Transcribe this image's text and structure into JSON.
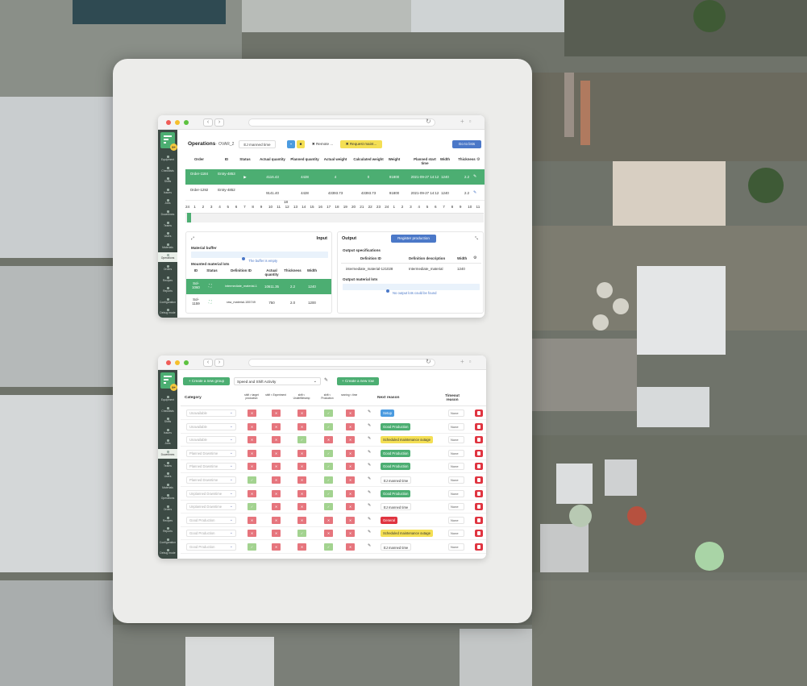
{
  "colors": {
    "green": "#4cae72",
    "red": "#e6757d",
    "blue": "#4b78c8",
    "yellow": "#f4df54",
    "lightgreen": "#a3d390",
    "sidebar": "#3c4a44"
  },
  "browser": {
    "reload_icon": "reload-icon",
    "back_icon": "chevron-left-icon",
    "forward_icon": "chevron-right-icon"
  },
  "win1": {
    "sidebar": [
      "Equipment",
      "Checklists",
      "Shifts",
      "Issues",
      "Jobs",
      "Downtimes",
      "Teams",
      "Users",
      "Materials",
      "Operations",
      "Orders",
      "Recipes",
      "Reports",
      "Configuration",
      "Debug mode"
    ],
    "active_sidebar": 9,
    "title": "Operations",
    "subtitle": "· OVAR_2",
    "planned_time_chip": "EJ manned time",
    "remote_btn": "✖ Remote ...",
    "request_btn": "✖ Request maint...",
    "gotolist_btn": "Go to lists",
    "columns": [
      "Order",
      "ID",
      "Status",
      "Actual quantity",
      "Planned quantity",
      "Actual weight",
      "Calculated weight",
      "Weight",
      "Planned start time",
      "Width",
      "Thickness"
    ],
    "rows": [
      {
        "order": "Order-1184",
        "id": "Entry-4853",
        "status": "▶",
        "actual_qty": "4116.43",
        "planned_qty": "4428",
        "actual_weight": "4",
        "calc_weight": "0",
        "weight": "91800",
        "start": "2021-09-27 14:12",
        "width": "1240",
        "thickness": "2.2"
      },
      {
        "order": "Order-1292",
        "id": "Entry-4852",
        "status": "",
        "actual_qty": "9141.40",
        "planned_qty": "4428",
        "actual_weight": "43393.73",
        "calc_weight": "43393.73",
        "weight": "91800",
        "start": "2021-09-27 14:12",
        "width": "1240",
        "thickness": "2.2"
      }
    ],
    "timeline_ticks": [
      "24",
      "1",
      "2",
      "3",
      "4",
      "5",
      "6",
      "7",
      "8",
      "9",
      "10",
      "11",
      "12",
      "13",
      "14",
      "15",
      "16",
      "17",
      "18",
      "19",
      "20",
      "21",
      "22",
      "23",
      "24",
      "1",
      "2",
      "3",
      "4",
      "5",
      "6",
      "7",
      "8",
      "9",
      "10",
      "11"
    ],
    "timeline_mid": "18",
    "input": {
      "title": "Input",
      "buffer_title": "Material buffer",
      "buffer_empty": "The buffer is empty",
      "mounted_title": "Mounted material lots",
      "cols": [
        "ID",
        "Status",
        "Definition ID",
        "Actual quantity",
        "Thickness",
        "Width"
      ],
      "rows": [
        {
          "id": "Sol-1060",
          "def": "intermediate_material-11071b",
          "qty": "10611.35",
          "th": "2.2",
          "w": "1240"
        },
        {
          "id": "Sol-1159",
          "def": "raw_material-155749",
          "qty": "750",
          "th": "2.0",
          "w": "1200"
        }
      ]
    },
    "output": {
      "title": "Output",
      "register_btn": "Register production",
      "spec_title": "Output specifications",
      "spec_cols": [
        "Definition ID",
        "Definition description",
        "Width"
      ],
      "spec_row": {
        "def": "intermediate_material-121028",
        "desc": "Intermediate_material",
        "w": "1240"
      },
      "lots_title": "Output material lots",
      "lots_empty": "No output lots could be found"
    }
  },
  "win2": {
    "sidebar": [
      "Equipment",
      "Checklists",
      "Shifts",
      "Issues",
      "Jobs",
      "Downtimes",
      "Teams",
      "Users",
      "Materials",
      "Operations",
      "Orders",
      "Recipes",
      "Reports",
      "Configuration",
      "Debug mode"
    ],
    "active_sidebar": 5,
    "create_group_btn": "+ Create a new group",
    "group_select": "Speed and Shift Activity",
    "create_row_btn": "+ Create a new row",
    "columns": {
      "category": "Category",
      "c1": "shift > target production",
      "c2": "shift < Experiment",
      "c3": "shift < Underfilleramp",
      "c4": "shift < Production",
      "c5": "running < time",
      "next": "Next reason",
      "timeout": "Timeout reason"
    },
    "rows": [
      {
        "cat": "Unavailable",
        "sq": [
          "r",
          "r",
          "r",
          "g",
          "r"
        ],
        "next": "Setup",
        "nc": "blue",
        "to": "None"
      },
      {
        "cat": "Unavailable",
        "sq": [
          "r",
          "r",
          "r",
          "g",
          "r"
        ],
        "next": "Good Production",
        "nc": "green",
        "to": "None"
      },
      {
        "cat": "Unavailable",
        "sq": [
          "r",
          "r",
          "g",
          "r",
          "r"
        ],
        "next": "Scheduled maintenance outage",
        "nc": "yellow",
        "to": "None"
      },
      {
        "cat": "Planned Downtime",
        "sq": [
          "r",
          "r",
          "r",
          "g",
          "r"
        ],
        "next": "Good Production",
        "nc": "green",
        "to": "None"
      },
      {
        "cat": "Planned Downtime",
        "sq": [
          "r",
          "r",
          "r",
          "g",
          "r"
        ],
        "next": "Good Production",
        "nc": "green",
        "to": "None"
      },
      {
        "cat": "Planned Downtime",
        "sq": [
          "g",
          "r",
          "r",
          "g",
          "r"
        ],
        "next": "EJ manned time",
        "nc": "white",
        "to": "None"
      },
      {
        "cat": "Unplanned Downtime",
        "sq": [
          "r",
          "r",
          "r",
          "g",
          "r"
        ],
        "next": "Good Production",
        "nc": "green",
        "to": "None"
      },
      {
        "cat": "Unplanned Downtime",
        "sq": [
          "g",
          "r",
          "r",
          "g",
          "r"
        ],
        "next": "EJ manned time",
        "nc": "white",
        "to": "None"
      },
      {
        "cat": "Good Production",
        "sq": [
          "r",
          "r",
          "r",
          "r",
          "r"
        ],
        "next": "General",
        "nc": "red",
        "to": "None"
      },
      {
        "cat": "Good Production",
        "sq": [
          "r",
          "r",
          "g",
          "r",
          "r"
        ],
        "next": "Scheduled maintenance outage",
        "nc": "yellow",
        "to": "None"
      },
      {
        "cat": "Good Production",
        "sq": [
          "g",
          "r",
          "r",
          "g",
          "r"
        ],
        "next": "EJ manned time",
        "nc": "white",
        "to": "None"
      }
    ]
  }
}
